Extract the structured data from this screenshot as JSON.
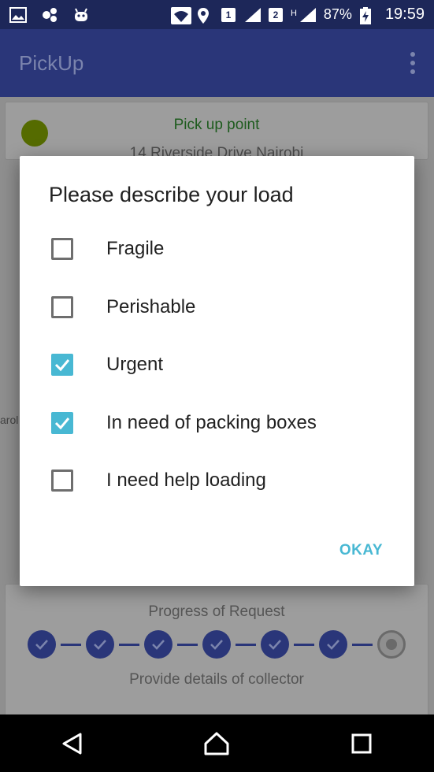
{
  "status_bar": {
    "sim1": "1",
    "sim2": "2",
    "network": "H",
    "battery": "87%",
    "time": "19:59"
  },
  "app_bar": {
    "title": "PickUp"
  },
  "background": {
    "pickup_label": "Pick up point",
    "pickup_address": "14 Riverside Drive Nairobi",
    "map_hint": "arol",
    "progress_title": "Progress of Request",
    "progress_subtitle": "Provide details of collector",
    "steps_completed": 6,
    "steps_total": 7
  },
  "dialog": {
    "title": "Please describe your load",
    "options": [
      {
        "label": "Fragile",
        "checked": false
      },
      {
        "label": "Perishable",
        "checked": false
      },
      {
        "label": "Urgent",
        "checked": true
      },
      {
        "label": "In need of packing boxes",
        "checked": true
      },
      {
        "label": "I need help loading",
        "checked": false
      }
    ],
    "okay_label": "OKAY"
  },
  "colors": {
    "accent": "#48b8d3",
    "primary": "#2a3679"
  }
}
